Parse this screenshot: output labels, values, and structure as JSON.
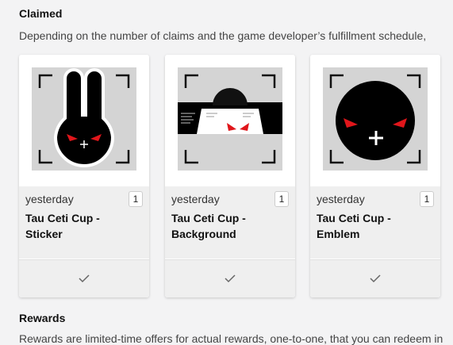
{
  "claimed": {
    "title": "Claimed",
    "description": "Depending on the number of claims and the game developer’s fulfillment schedule,"
  },
  "items": [
    {
      "date": "yesterday",
      "quantity": "1",
      "name": "Tau Ceti Cup - Sticker",
      "icon": "sticker-image"
    },
    {
      "date": "yesterday",
      "quantity": "1",
      "name": "Tau Ceti Cup - Background",
      "icon": "background-image"
    },
    {
      "date": "yesterday",
      "quantity": "1",
      "name": "Tau Ceti Cup - Emblem",
      "icon": "emblem-image"
    }
  ],
  "rewards": {
    "title": "Rewards",
    "description": "Rewards are limited-time offers for actual rewards, one-to-one, that you can redeem in"
  },
  "colors": {
    "card_bg": "#ffffff",
    "info_bg": "#efefef",
    "accent_red": "#e0161b"
  }
}
